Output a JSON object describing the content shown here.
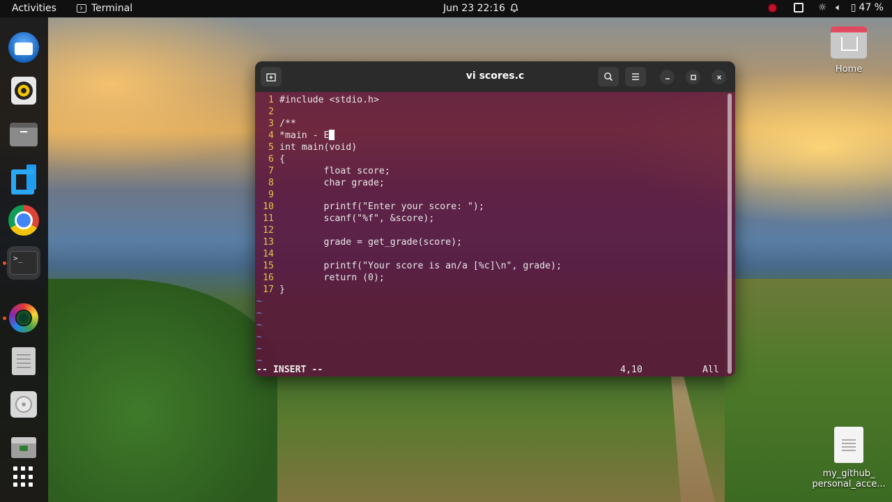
{
  "topbar": {
    "activities": "Activities",
    "app_name": "Terminal",
    "clock": "Jun 23  22:16",
    "battery": "47 %"
  },
  "dock": {
    "items": [
      "thunderbird",
      "rhythmbox",
      "files",
      "vscode",
      "chrome",
      "terminal",
      "cheese",
      "text-editor",
      "disks",
      "trash",
      "show-apps"
    ]
  },
  "desktop": {
    "home_label": "Home",
    "file_label_1": "my_github_",
    "file_label_2": "personal_acce..."
  },
  "window": {
    "title": "vi scores.c",
    "lines": [
      {
        "n": "1",
        "text": "#include <stdio.h>"
      },
      {
        "n": "2",
        "text": ""
      },
      {
        "n": "3",
        "text": "/**"
      },
      {
        "n": "4",
        "text": "*main - E"
      },
      {
        "n": "5",
        "text": "int main(void)"
      },
      {
        "n": "6",
        "text": "{"
      },
      {
        "n": "7",
        "text": "        float score;"
      },
      {
        "n": "8",
        "text": "        char grade;"
      },
      {
        "n": "9",
        "text": ""
      },
      {
        "n": "10",
        "text": "        printf(\"Enter your score: \");"
      },
      {
        "n": "11",
        "text": "        scanf(\"%f\", &score);"
      },
      {
        "n": "12",
        "text": ""
      },
      {
        "n": "13",
        "text": "        grade = get_grade(score);"
      },
      {
        "n": "14",
        "text": ""
      },
      {
        "n": "15",
        "text": "        printf(\"Your score is an/a [%c]\\n\", grade);"
      },
      {
        "n": "16",
        "text": "        return (0);"
      },
      {
        "n": "17",
        "text": "}"
      }
    ],
    "tilde": "~",
    "status_mode": "-- INSERT --",
    "status_pos": "4,10",
    "status_all": "All"
  },
  "colors": {
    "line_number": "#e3c44a",
    "tilde": "#6e8fd8",
    "terminal_bg": "#5c143a"
  }
}
